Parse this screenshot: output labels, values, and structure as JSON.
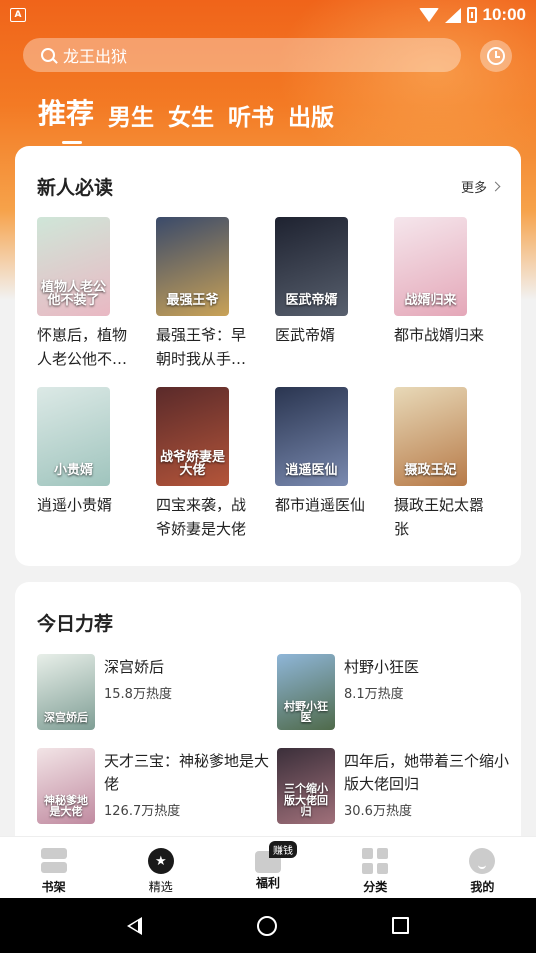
{
  "status_bar": {
    "time": "10:00",
    "app_badge": "A"
  },
  "search": {
    "query": "龙王出狱"
  },
  "tabs": [
    {
      "label": "推荐",
      "active": true
    },
    {
      "label": "男生",
      "active": false
    },
    {
      "label": "女生",
      "active": false
    },
    {
      "label": "听书",
      "active": false
    },
    {
      "label": "出版",
      "active": false
    }
  ],
  "newbie": {
    "title": "新人必读",
    "more": "更多",
    "books": [
      {
        "name": "怀崽后，植物人老公他不装了",
        "cover_text": "植物人老公他不装了",
        "cover_colors": [
          "#cfe6d8",
          "#e9b8c3"
        ]
      },
      {
        "name": "最强王爷：早朝时我从手表里抽出一台机枪",
        "cover_text": "最强王爷",
        "cover_colors": [
          "#3a4a6a",
          "#c9a257"
        ]
      },
      {
        "name": "医武帝婿",
        "cover_text": "医武帝婿",
        "cover_colors": [
          "#1e2230",
          "#58606e"
        ]
      },
      {
        "name": "都市战婿归来",
        "cover_text": "战婿归来",
        "cover_colors": [
          "#f5e6ec",
          "#e4a7b8"
        ]
      },
      {
        "name": "逍遥小贵婿",
        "cover_text": "小贵婿",
        "cover_colors": [
          "#dce9e6",
          "#9fc4bd"
        ]
      },
      {
        "name": "四宝来袭，战爷娇妻是大佬",
        "cover_text": "战爷娇妻是大佬",
        "cover_colors": [
          "#5a2a2a",
          "#b4553a"
        ]
      },
      {
        "name": "都市逍遥医仙",
        "cover_text": "逍遥医仙",
        "cover_colors": [
          "#2a3550",
          "#7a8ab0"
        ]
      },
      {
        "name": "摄政王妃太嚣张",
        "cover_text": "摄政王妃",
        "cover_colors": [
          "#e8d9b8",
          "#b77a48"
        ]
      }
    ]
  },
  "today": {
    "title": "今日力荐",
    "books": [
      {
        "name": "深宫娇后",
        "heat": "15.8万热度",
        "cover_text": "深宫娇后",
        "cover_colors": [
          "#e8efe9",
          "#7f9e95"
        ]
      },
      {
        "name": "村野小狂医",
        "heat": "8.1万热度",
        "cover_text": "村野小狂医",
        "cover_colors": [
          "#8fb6d8",
          "#4f6a4a"
        ]
      },
      {
        "name": "天才三宝：神秘爹地是大佬",
        "heat": "126.7万热度",
        "cover_text": "神秘爹地是大佬",
        "cover_colors": [
          "#f2e4e6",
          "#c08aa0"
        ]
      },
      {
        "name": "四年后，她带着三个缩小版大佬回归",
        "heat": "30.6万热度",
        "cover_text": "三个缩小版大佬回归",
        "cover_colors": [
          "#3b2f3a",
          "#a0707a"
        ]
      }
    ]
  },
  "bottom_nav": {
    "items": [
      {
        "label": "书架",
        "icon": "bookshelf-icon"
      },
      {
        "label": "精选",
        "icon": "star-icon"
      },
      {
        "label": "福利",
        "icon": "gift-icon",
        "badge": "赚钱"
      },
      {
        "label": "分类",
        "icon": "category-icon"
      },
      {
        "label": "我的",
        "icon": "profile-icon"
      }
    ]
  }
}
